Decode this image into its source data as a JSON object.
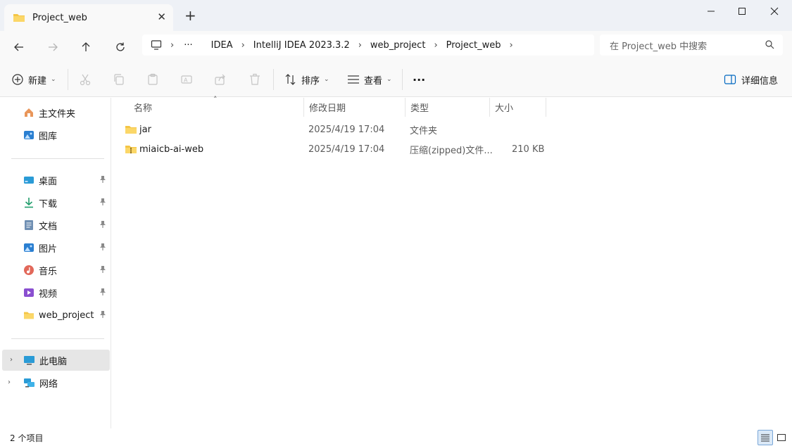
{
  "window": {
    "tab_title": "Project_web",
    "close_tab": "✕",
    "new_tab": "+"
  },
  "nav": {
    "breadcrumbs": [
      "IDEA",
      "IntelliJ IDEA 2023.3.2",
      "web_project",
      "Project_web"
    ],
    "ellipsis": "···",
    "search_placeholder": "在 Project_web 中搜索"
  },
  "toolbar": {
    "new_label": "新建",
    "sort_label": "排序",
    "view_label": "查看",
    "more_label": "···",
    "details_label": "详细信息"
  },
  "sidebar": {
    "quick": [
      {
        "label": "主文件夹",
        "icon": "home-icon"
      },
      {
        "label": "图库",
        "icon": "gallery-icon"
      }
    ],
    "pinned": [
      {
        "label": "桌面",
        "icon": "desktop-icon"
      },
      {
        "label": "下载",
        "icon": "download-icon"
      },
      {
        "label": "文档",
        "icon": "document-icon"
      },
      {
        "label": "图片",
        "icon": "pictures-icon"
      },
      {
        "label": "音乐",
        "icon": "music-icon"
      },
      {
        "label": "视频",
        "icon": "video-icon"
      },
      {
        "label": "web_project",
        "icon": "folder-icon"
      }
    ],
    "devices": [
      {
        "label": "此电脑",
        "icon": "computer-icon"
      },
      {
        "label": "网络",
        "icon": "network-icon"
      }
    ]
  },
  "columns": {
    "name": "名称",
    "modified": "修改日期",
    "type": "类型",
    "size": "大小"
  },
  "files": [
    {
      "name": "jar",
      "modified": "2025/4/19 17:04",
      "type": "文件夹",
      "size": "",
      "icon": "folder-icon"
    },
    {
      "name": "miaicb-ai-web",
      "modified": "2025/4/19 17:04",
      "type": "压缩(zipped)文件...",
      "size": "210 KB",
      "icon": "zip-folder-icon"
    }
  ],
  "status": {
    "count_text": "2 个项目"
  },
  "colors": {
    "folder": "#f4c545",
    "accent": "#0067c0"
  }
}
